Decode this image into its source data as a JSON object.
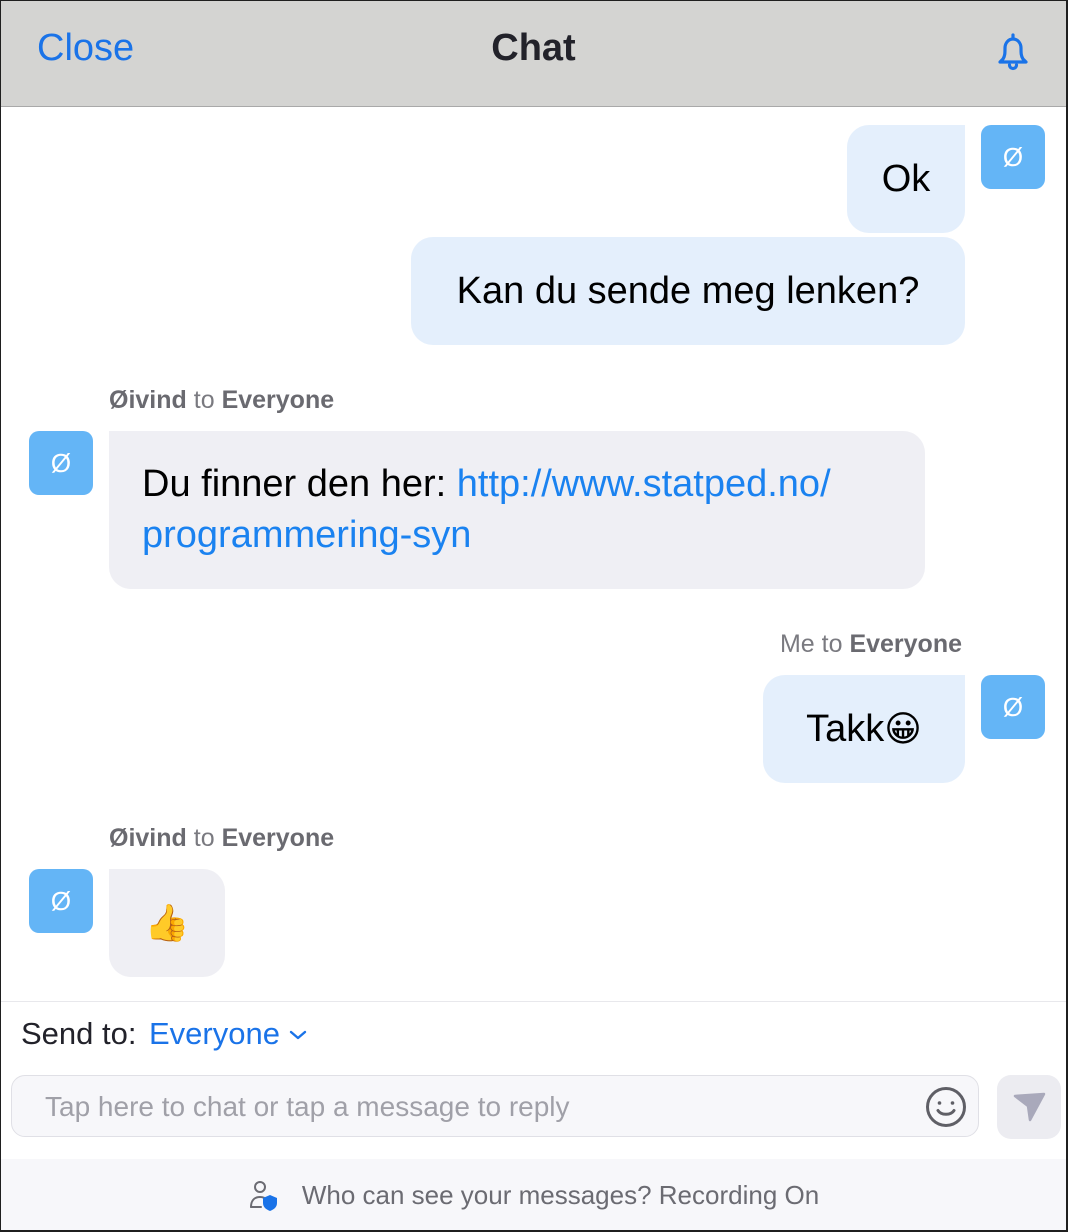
{
  "header": {
    "close_label": "Close",
    "title": "Chat",
    "notification_icon": "bell-icon"
  },
  "messages": [
    {
      "direction": "sent",
      "avatar_initial": "Ø",
      "text": "Ok"
    },
    {
      "direction": "sent",
      "text": "Kan du sende meg lenken?"
    },
    {
      "direction": "received",
      "sender": "Øivind",
      "to_word": "to",
      "recipient": "Everyone",
      "avatar_initial": "Ø",
      "text": "Du finner den her: ",
      "link_line1": "http://www.statped.no/",
      "link_line2": "programmering-syn"
    },
    {
      "direction": "sent",
      "sender": "Me",
      "to_word": "to",
      "recipient": "Everyone",
      "avatar_initial": "Ø",
      "text": "Takk",
      "emoji": "😀"
    },
    {
      "direction": "received",
      "sender": "Øivind",
      "to_word": "to",
      "recipient": "Everyone",
      "avatar_initial": "Ø",
      "emoji": "👍"
    }
  ],
  "composer": {
    "send_to_label": "Send to:",
    "send_to_value": "Everyone",
    "placeholder": "Tap here to chat or tap a message to reply",
    "emoji_icon": "smiley-icon",
    "send_icon": "send-icon"
  },
  "footer": {
    "privacy_text": "Who can see your messages? Recording On",
    "privacy_icon": "person-shield-icon"
  },
  "colors": {
    "accent": "#1a73e8",
    "avatar": "#64b5f6",
    "sent_bubble": "#e4effc",
    "received_bubble": "#efeff4",
    "header_bg": "#d4d4d2"
  }
}
